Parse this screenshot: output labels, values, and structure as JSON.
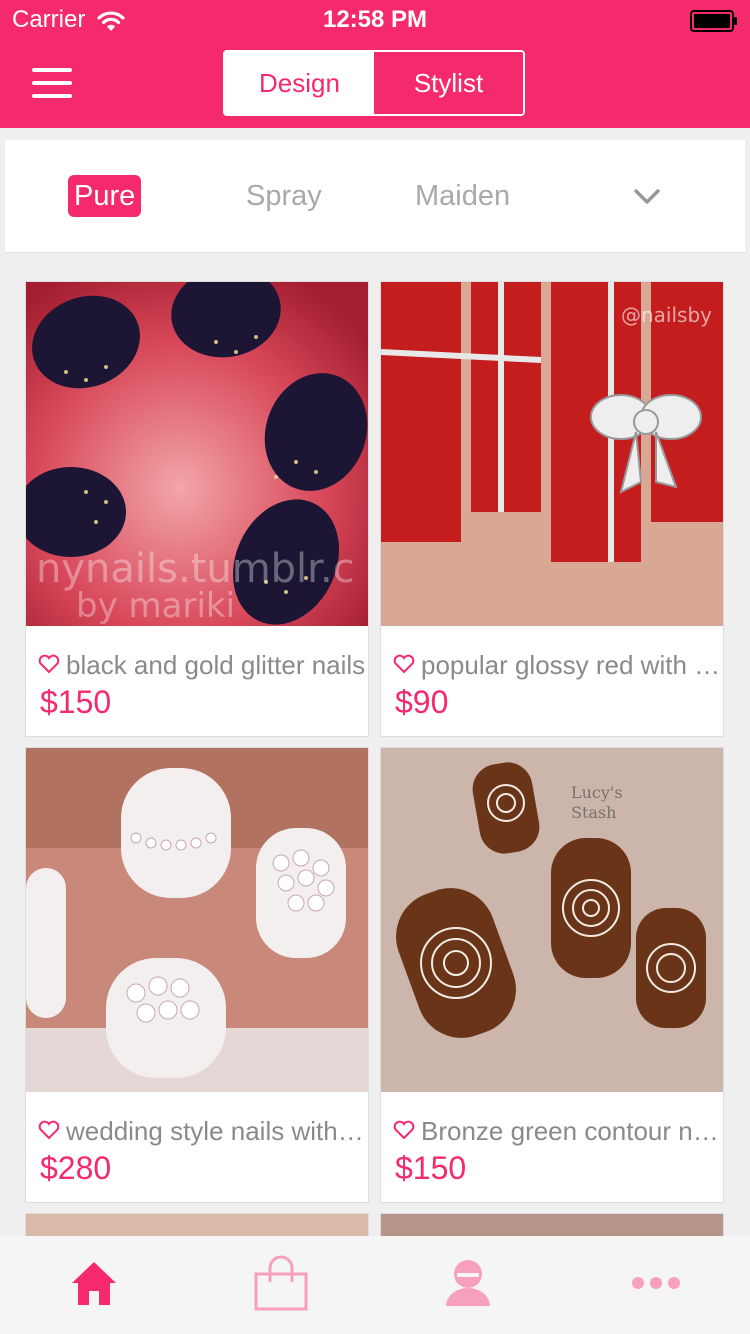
{
  "status_bar": {
    "carrier": "Carrier",
    "time": "12:58 PM"
  },
  "header": {
    "menu_icon": "hamburger-icon",
    "segments": [
      {
        "label": "Design",
        "active": true
      },
      {
        "label": "Stylist",
        "active": false
      }
    ]
  },
  "categories": {
    "items": [
      {
        "label": "Pure",
        "active": true
      },
      {
        "label": "Spray",
        "active": false
      },
      {
        "label": "Maiden",
        "active": false
      }
    ],
    "expand_icon": "chevron-down-icon"
  },
  "products": [
    {
      "title": "black and gold glitter nails",
      "price": "$150",
      "image": "black-gold-glitter-nails-photo"
    },
    {
      "title": "popular glossy red with bow",
      "price": "$90",
      "image": "red-bow-nails-photo"
    },
    {
      "title": "wedding style nails with rhinestones",
      "price": "$280",
      "image": "white-rhinestone-nails-photo"
    },
    {
      "title": "Bronze green contour nails",
      "price": "$150",
      "image": "bronze-mandala-nails-photo"
    }
  ],
  "tabbar": {
    "items": [
      {
        "icon": "home-icon",
        "active": true
      },
      {
        "icon": "shopping-bag-icon",
        "active": false
      },
      {
        "icon": "user-icon",
        "active": false
      },
      {
        "icon": "more-icon",
        "active": false
      }
    ]
  },
  "colors": {
    "accent": "#f52a6c",
    "accent_light": "#f7a0bd",
    "background": "#efefef"
  }
}
